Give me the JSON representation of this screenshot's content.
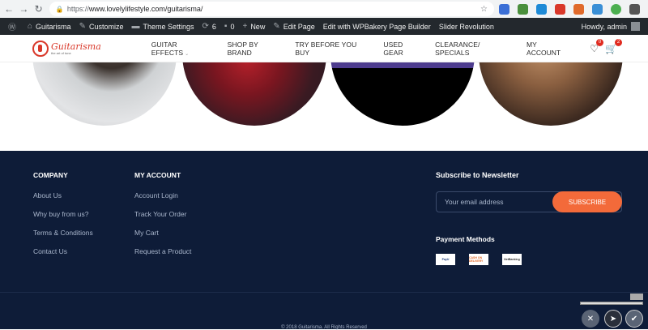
{
  "browser": {
    "url_scheme": "https://",
    "url_host": "www.lovelylifestyle.com/guitarisma/"
  },
  "wp_bar": {
    "site_name": "Guitarisma",
    "customize": "Customize",
    "theme_settings": "Theme Settings",
    "updates_count": "6",
    "comments_count": "0",
    "new": "New",
    "edit_page": "Edit Page",
    "edit_wpbakery": "Edit with WPBakery Page Builder",
    "slider_revolution": "Slider Revolution",
    "howdy": "Howdy, admin"
  },
  "header": {
    "logo_name": "Guitarisma",
    "logo_tagline": "the art of tone",
    "nav": [
      {
        "label": "Guitar Effects",
        "has_caret": true
      },
      {
        "label": "Shop by Brand"
      },
      {
        "label": "Try Before You Buy"
      },
      {
        "label": "Used Gear"
      },
      {
        "label": "Clearance/ Specials"
      }
    ],
    "my_account": "My Account",
    "wishlist_count": "0",
    "cart_count": "2"
  },
  "footer": {
    "company": {
      "title": "Company",
      "links": [
        "About Us",
        "Why buy from us?",
        "Terms & Conditions",
        "Contact Us"
      ]
    },
    "account": {
      "title": "My Account",
      "links": [
        "Account Login",
        "Track Your Order",
        "My Cart",
        "Request a Product"
      ]
    },
    "newsletter": {
      "title": "Subscribe to Newsletter",
      "placeholder": "Your email address",
      "button": "Subscribe"
    },
    "payment": {
      "title": "Payment Methods",
      "methods": [
        "PayU",
        "CASH ON DELIVERY",
        "NetBanking"
      ]
    },
    "copyright": "© 2018 Guitarisma. All Rights Reserved"
  },
  "colors": {
    "footer_bg": "#0e1c38",
    "accent": "#f36a3a",
    "brand_red": "#d9382a",
    "wp_bar": "#23282d"
  }
}
